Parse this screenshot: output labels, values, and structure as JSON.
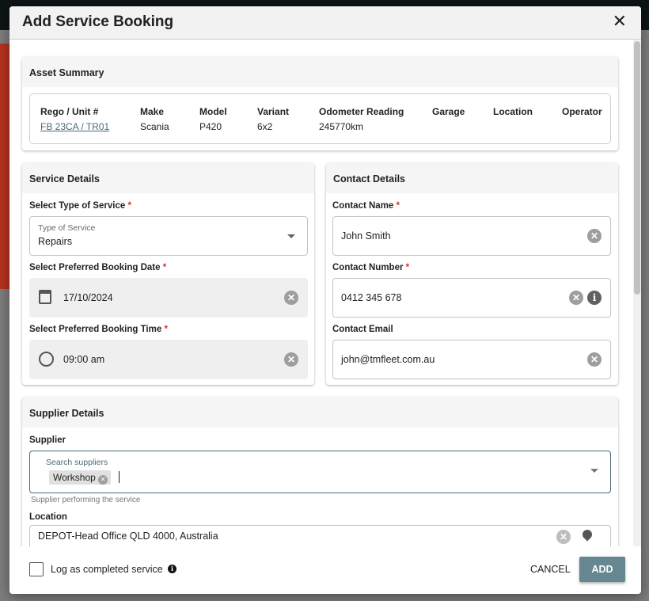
{
  "dialog": {
    "title": "Add Service Booking",
    "close_icon": "close-icon"
  },
  "asset_summary": {
    "title": "Asset Summary",
    "columns": [
      {
        "label": "Rego / Unit #",
        "value": "FB 23CA / TR01"
      },
      {
        "label": "Make",
        "value": "Scania"
      },
      {
        "label": "Model",
        "value": "P420"
      },
      {
        "label": "Variant",
        "value": "6x2"
      },
      {
        "label": "Odometer Reading",
        "value": "245770km"
      },
      {
        "label": "Garage",
        "value": ""
      },
      {
        "label": "Location",
        "value": ""
      },
      {
        "label": "Operator",
        "value": ""
      }
    ]
  },
  "service_details": {
    "title": "Service Details",
    "type_label": "Select Type of Service",
    "type_floating_label": "Type of Service",
    "type_value": "Repairs",
    "date_label": "Select Preferred Booking Date",
    "date_value": "17/10/2024",
    "time_label": "Select Preferred Booking Time",
    "time_value": "09:00 am",
    "required_mark": "*"
  },
  "contact_details": {
    "title": "Contact Details",
    "name_label": "Contact Name",
    "name_value": "John Smith",
    "number_label": "Contact Number",
    "number_value": "0412 345 678",
    "email_label": "Contact Email",
    "email_value": "john@tmfleet.com.au"
  },
  "supplier_details": {
    "title": "Supplier Details",
    "supplier_label": "Supplier",
    "search_label": "Search suppliers",
    "chip": "Workshop",
    "helper": "Supplier performing the service",
    "location_label": "Location",
    "location_value": "DEPOT-Head Office QLD 4000, Australia"
  },
  "footer": {
    "checkbox_label": "Log as completed service",
    "checked": false,
    "cancel": "CANCEL",
    "add": "ADD"
  },
  "colors": {
    "accent": "#668791",
    "link": "#4a6b78",
    "required": "#d32f2f"
  }
}
